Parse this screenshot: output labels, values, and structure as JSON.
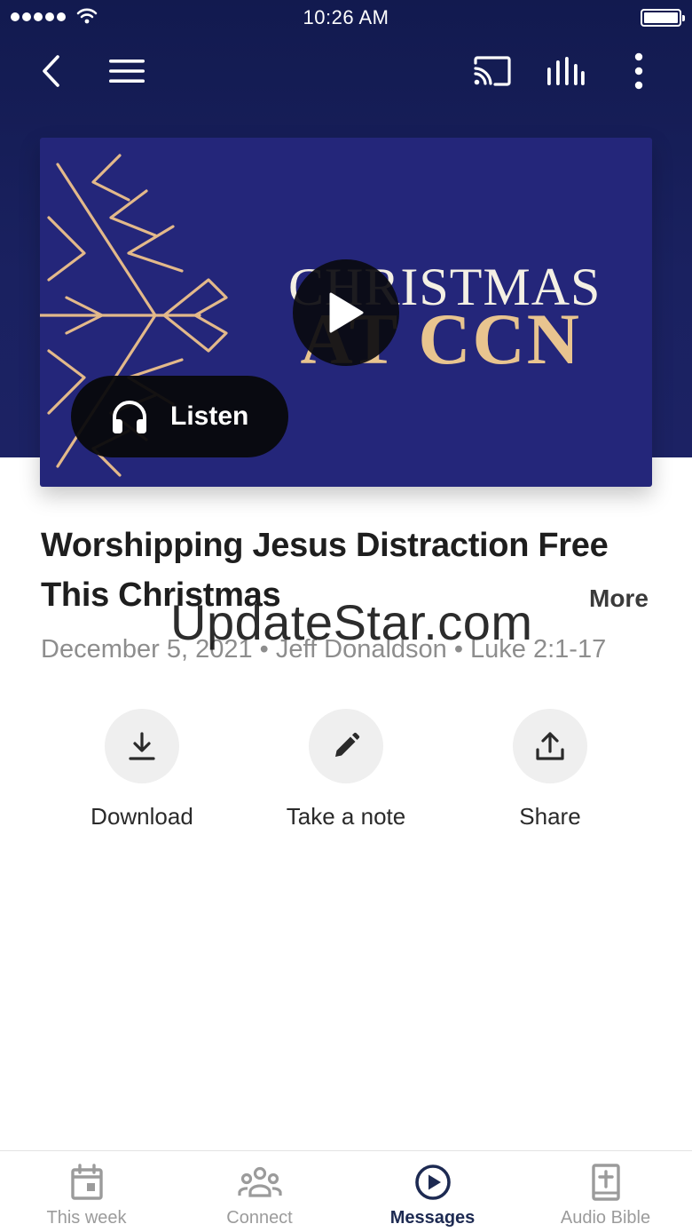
{
  "status_bar": {
    "time": "10:26 AM"
  },
  "artwork": {
    "title_line1": "CHRISTMAS",
    "title_line2": "AT CCN"
  },
  "listen_button": {
    "label": "Listen"
  },
  "sermon": {
    "title": "Worshipping Jesus Distraction Free This Christmas",
    "more_label": "More",
    "meta": "December 5, 2021 • Jeff Donaldson • Luke 2:1-17"
  },
  "watermark": "UpdateStar.com",
  "actions": [
    {
      "label": "Download",
      "icon": "download-icon"
    },
    {
      "label": "Take a note",
      "icon": "pencil-icon"
    },
    {
      "label": "Share",
      "icon": "share-icon"
    }
  ],
  "tabs": [
    {
      "label": "This week",
      "icon": "calendar-icon",
      "active": false
    },
    {
      "label": "Connect",
      "icon": "people-icon",
      "active": false
    },
    {
      "label": "Messages",
      "icon": "play-circle-icon",
      "active": true
    },
    {
      "label": "Audio Bible",
      "icon": "bible-icon",
      "active": false
    }
  ],
  "colors": {
    "header_bg": "#1a2160",
    "artwork_bg": "#24267a",
    "artwork_gold": "#e8c48f",
    "active_tab": "#1d2a52",
    "inactive_tab": "#9b9b9b"
  }
}
